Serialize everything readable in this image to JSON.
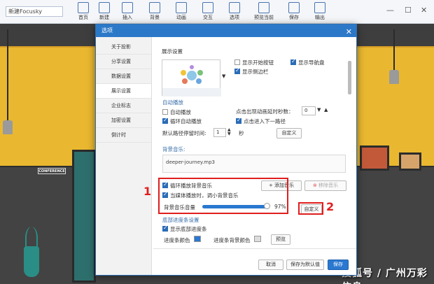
{
  "app": {
    "doc_title": "新建Focusky",
    "toolbar": [
      {
        "label": "首页",
        "icon": "home-icon"
      },
      {
        "label": "新建",
        "icon": "new-file-icon"
      },
      {
        "label": "插入",
        "icon": "insert-icon"
      },
      {
        "label": "背景",
        "icon": "background-icon"
      },
      {
        "label": "动画",
        "icon": "animation-icon"
      },
      {
        "label": "交互",
        "icon": "interaction-icon"
      },
      {
        "label": "选项",
        "icon": "options-icon"
      },
      {
        "label": "预览当前",
        "icon": "preview-icon"
      },
      {
        "label": "保存",
        "icon": "save-icon"
      },
      {
        "label": "输出",
        "icon": "export-icon"
      }
    ]
  },
  "scene": {
    "conference_sign": "CONFERENCE",
    "watermark": "搜狐号 / 广州万彩信息"
  },
  "dialog": {
    "title": "选项",
    "close": "✕",
    "nav": [
      "关于投影",
      "分享设置",
      "数据设置",
      "展示设置",
      "企业标志",
      "加密设置",
      "倒计时"
    ],
    "active_nav": "展示设置",
    "display_settings_title": "展示设置",
    "show_start_button": "显示开始按钮",
    "show_navigation": "显示导航盘",
    "show_sidebar": "显示侧边栏",
    "autoplay_title": "自动播放",
    "autoplay": "自动播放",
    "loop_autoplay": "循环自动播放",
    "click_anim_seconds_label": "点击出现动画延时秒数：",
    "click_anim_seconds_value": "0",
    "click_next_path": "点击进入下一路径",
    "path_stay_label": "默认路径停留时间:",
    "path_stay_value": "1",
    "path_stay_unit": "秒",
    "customize_1": "自定义",
    "bgm_title": "背景音乐:",
    "bgm_file": "deeper-journey.mp3",
    "loop_bgm": "循环播放背景音乐",
    "duck_media": "当媒体播放时，调小背景音乐",
    "add_music": "添加音乐",
    "remove_music": "移除音乐",
    "volume_label": "背景音乐音量",
    "volume_value": "97%",
    "volume_level": 0.97,
    "customize_2": "自定义",
    "bottom_progress_title": "底部进度条设置",
    "show_bottom_progress": "显示底部进度条",
    "progress_color_label": "进度条颜色",
    "progress_bg_color_label": "进度条背景颜色",
    "preview": "预览",
    "cancel": "取消",
    "save_default": "保存为默认值",
    "save": "保存",
    "annotation_1": "1",
    "annotation_2": "2"
  }
}
